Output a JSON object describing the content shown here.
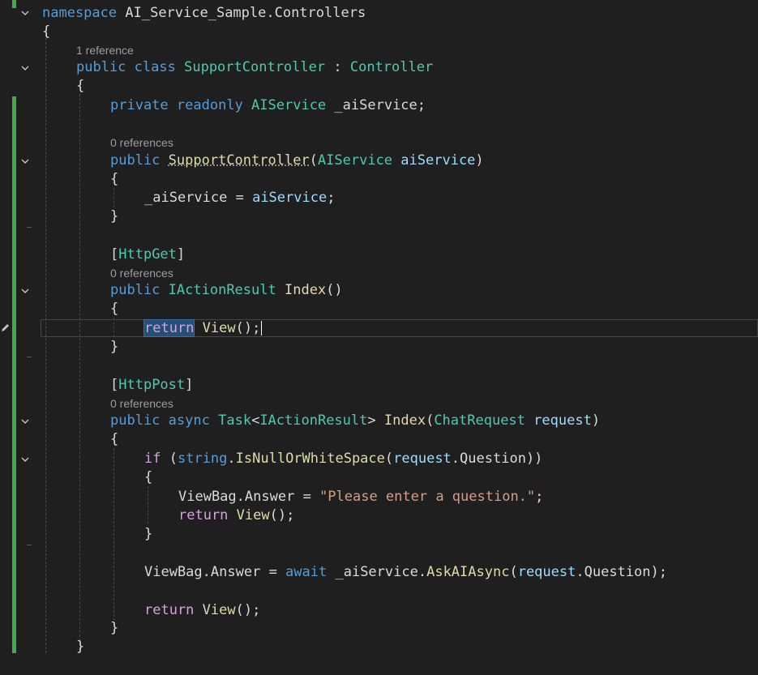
{
  "editor": {
    "lines": {
      "namespace_kw": "namespace",
      "namespace_name": "AI_Service_Sample.Controllers",
      "brace_open": "{",
      "brace_close": "}",
      "ref1": "1 reference",
      "class_public": "public",
      "class_kw": "class",
      "class_name": "SupportController",
      "class_colon": ":",
      "class_base": "Controller",
      "field_private": "private",
      "field_readonly": "readonly",
      "field_type": "AIService",
      "field_name": "_aiService;",
      "ref0": "0 references",
      "ctor_public": "public",
      "ctor_name": "SupportController",
      "ctor_type": "AIService",
      "ctor_param": "aiService",
      "assign_left": "_aiService",
      "assign_eq": " = ",
      "assign_right": "aiService",
      "attr_get": "HttpGet",
      "attr_post": "HttpPost",
      "m1_public": "public",
      "m1_type": "IActionResult",
      "m1_name": "Index",
      "return_kw": "return",
      "view_fn": "View",
      "m2_public": "public",
      "m2_async": "async",
      "m2_task": "Task",
      "m2_type": "IActionResult",
      "m2_name": "Index",
      "m2_ptype": "ChatRequest",
      "m2_param": "request",
      "if_kw": "if",
      "string_kw": "string",
      "isnull_fn": "IsNullOrWhiteSpace",
      "request_var": "request",
      "question_prop": "Question",
      "viewbag": "ViewBag",
      "answer_prop": "Answer",
      "please_str": "\"Please enter a question.\"",
      "await_kw": "await",
      "aiservice_field": "_aiService",
      "askai_fn": "AskAIAsync"
    }
  }
}
